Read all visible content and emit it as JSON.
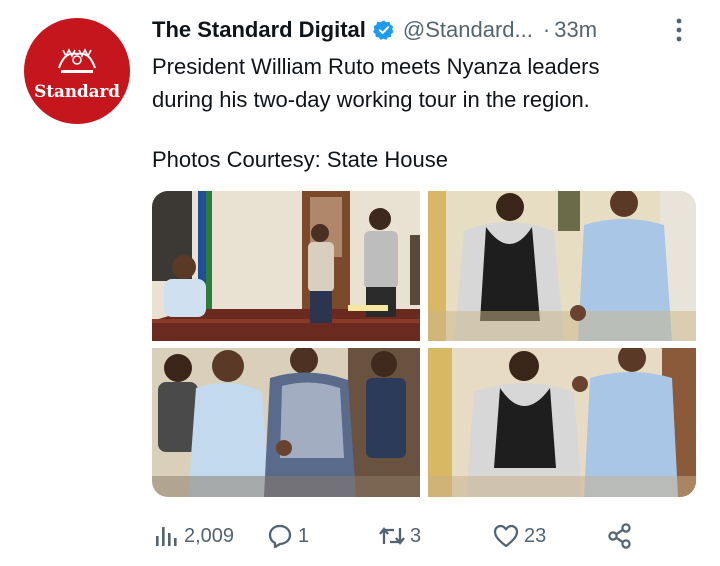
{
  "account": {
    "avatar_text": "Standard",
    "name": "The Standard Digital",
    "handle": "@Standard...",
    "separator": "·",
    "time": "33m",
    "verified": true
  },
  "tweet": {
    "lines": [
      "President William Ruto meets Nyanza leaders",
      "during his two-day working tour in the region."
    ],
    "credit": "Photos Courtesy: State House"
  },
  "photos": [
    {
      "name": "meeting-room-photo"
    },
    {
      "name": "greeting-photo-1"
    },
    {
      "name": "handshake-photo"
    },
    {
      "name": "greeting-photo-2"
    }
  ],
  "actions": {
    "views": "2,009",
    "replies": "1",
    "retweets": "3",
    "likes": "23"
  },
  "colors": {
    "brand_red": "#c4161c",
    "verified_blue": "#1d9bf0",
    "text_primary": "#0f1419",
    "text_secondary": "#536471"
  },
  "icons": [
    "verified-badge-icon",
    "more-icon",
    "views-icon",
    "reply-icon",
    "retweet-icon",
    "like-icon",
    "share-icon"
  ]
}
